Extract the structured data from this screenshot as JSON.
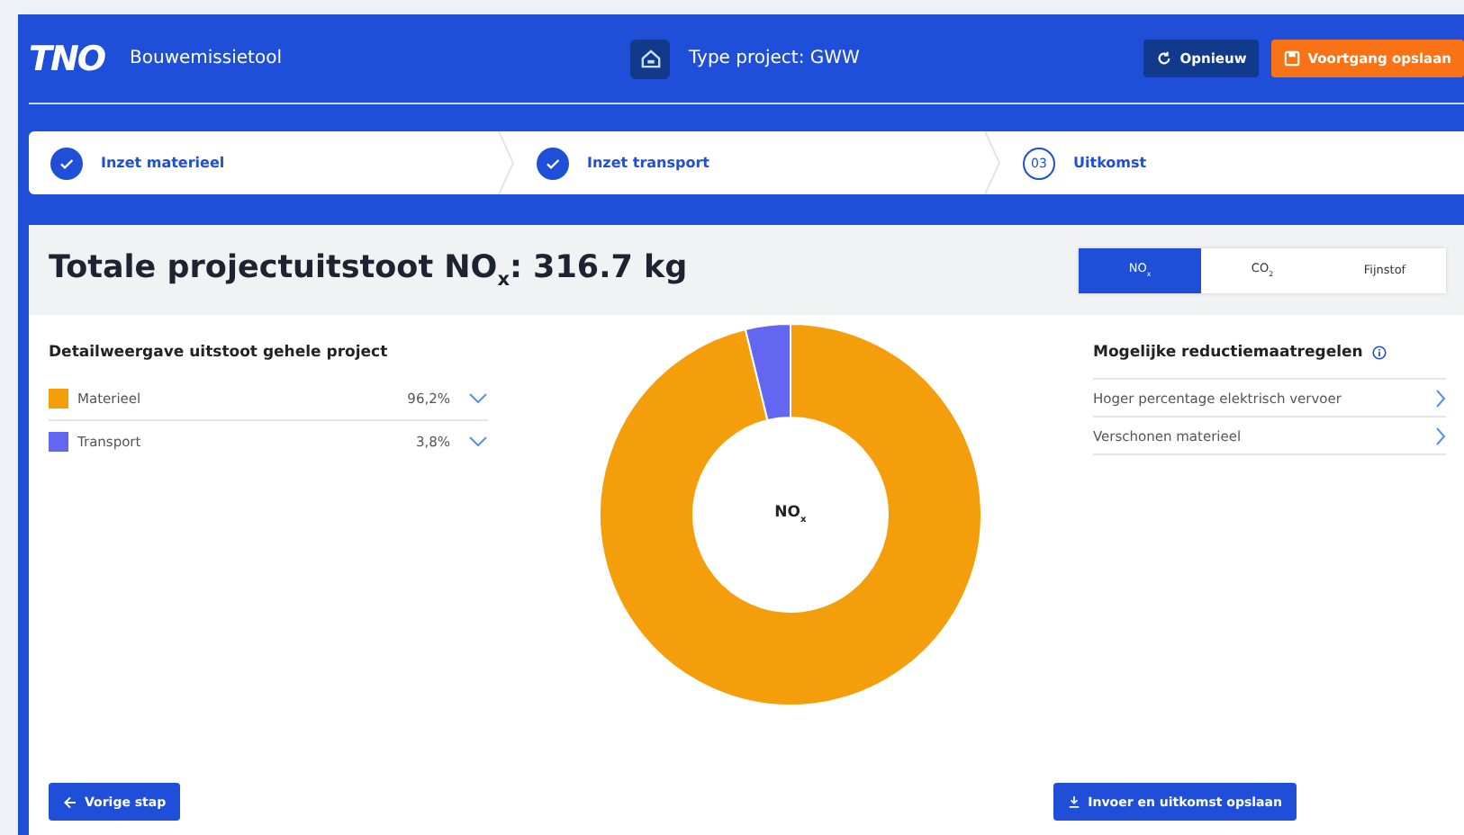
{
  "header": {
    "logo": "TNO",
    "app_name": "Bouwemissietool",
    "project_type": "Type project: GWW",
    "buttons": [
      {
        "label": "Opnieuw",
        "kind": "reset"
      },
      {
        "label": "Voortgang opslaan",
        "kind": "save"
      }
    ]
  },
  "steps": [
    {
      "label": "Inzet materieel",
      "done": true
    },
    {
      "label": "Inzet transport",
      "done": true
    },
    {
      "number": "03",
      "label": "Uitkomst",
      "done": false
    }
  ],
  "result": {
    "title": "Totale projectuitstoot NO$_{x}$: 316.7 kg",
    "tabs": [
      {
        "label": "NO$_{x}$",
        "selected": true
      },
      {
        "label": "CO$_{2}$",
        "selected": false
      },
      {
        "label": "Fijnstof",
        "selected": false
      }
    ],
    "detail_heading": "Detailweergave uitstoot gehele project",
    "legend": [
      {
        "label": "Materieel",
        "share": "96,2%",
        "color": "#f59e0b"
      },
      {
        "label": "Transport",
        "share": "3,8%",
        "color": "#6366f1"
      }
    ],
    "chart_data": {
      "type": "donut",
      "values": [
        96.2,
        3.8
      ],
      "annotations": [
        "NO$_{x}$"
      ]
    },
    "measures_heading": "Mogelijke reductiemaatregelen",
    "measures": [
      "Hoger percentage elektrisch vervoer",
      "Verschonen materieel"
    ]
  },
  "footer": {
    "back": "Vorige stap",
    "save": "Invoer en uitkomst opslaan"
  }
}
